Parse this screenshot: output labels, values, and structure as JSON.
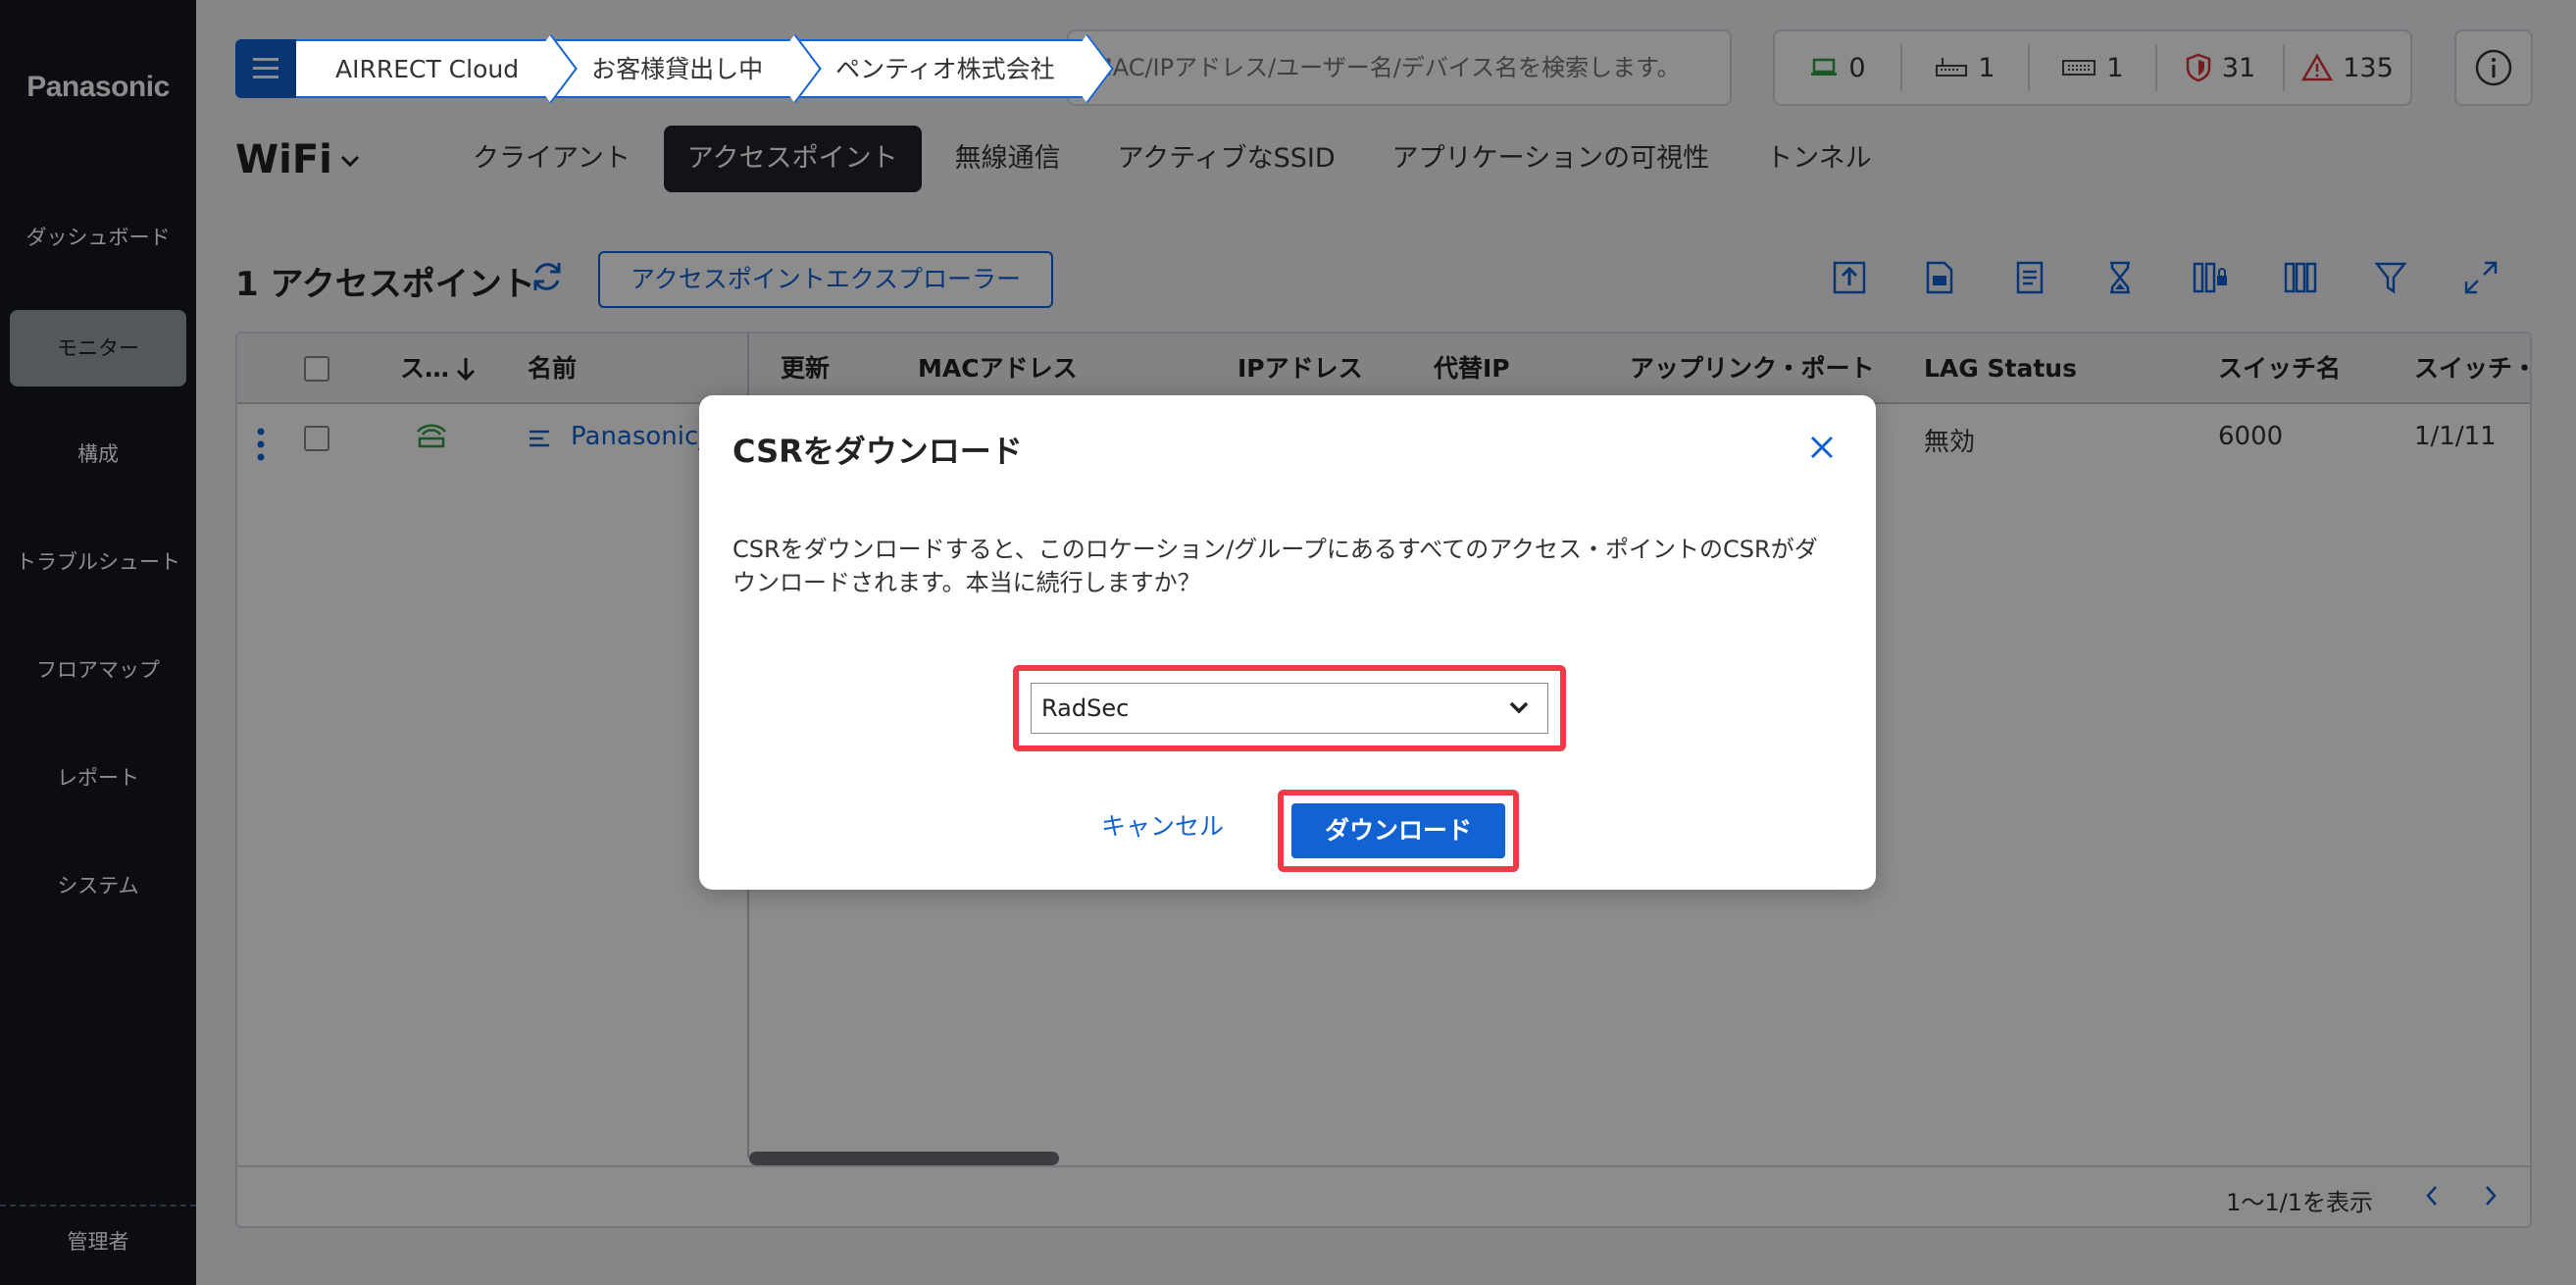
{
  "brand": {
    "logo": "Panasonic"
  },
  "sidebar": {
    "items": [
      {
        "label": "ダッシュボード"
      },
      {
        "label": "モニター"
      },
      {
        "label": "構成"
      },
      {
        "label": "トラブルシュート"
      },
      {
        "label": "フロアマップ"
      },
      {
        "label": "レポート"
      },
      {
        "label": "システム"
      }
    ],
    "active_index": 1,
    "footer_label": "管理者"
  },
  "breadcrumb": [
    "AIRRECT Cloud",
    "お客様貸出し中",
    "ペンティオ株式会社"
  ],
  "search": {
    "placeholder": "MAC/IPアドレス/ユーザー名/デバイス名を検索します。"
  },
  "stats": {
    "clients": "0",
    "switches": "1",
    "gateways": "1",
    "security": "31",
    "alerts": "135"
  },
  "page": {
    "section": "WiFi",
    "tabs": [
      "クライアント",
      "アクセスポイント",
      "無線通信",
      "アクティブなSSID",
      "アプリケーションの可視性",
      "トンネル"
    ],
    "active_tab_index": 1,
    "count_label": "1 アクセスポイント",
    "explorer_button": "アクセスポイントエクスプローラー"
  },
  "table": {
    "headers": [
      "ス…",
      "名前",
      "更新",
      "MACアドレス",
      "IPアドレス",
      "代替IP",
      "アップリンク・ポート",
      "LAG Status",
      "スイッチ名",
      "スイッチ・…"
    ],
    "row": {
      "name": "Panasonic_",
      "lag_status": "無効",
      "switch_name": "6000",
      "switch_port": "1/1/11"
    },
    "pager_text": "1〜1/1を表示"
  },
  "modal": {
    "title": "CSRをダウンロード",
    "message": "CSRをダウンロードすると、このロケーション/グループにあるすべてのアクセス・ポイントのCSRがダウンロードされます。本当に続行しますか？",
    "select_value": "RadSec",
    "cancel_label": "キャンセル",
    "download_label": "ダウンロード"
  },
  "colors": {
    "accent": "#1262d2",
    "highlight": "#f03a47",
    "sidebar_bg": "#161923"
  }
}
